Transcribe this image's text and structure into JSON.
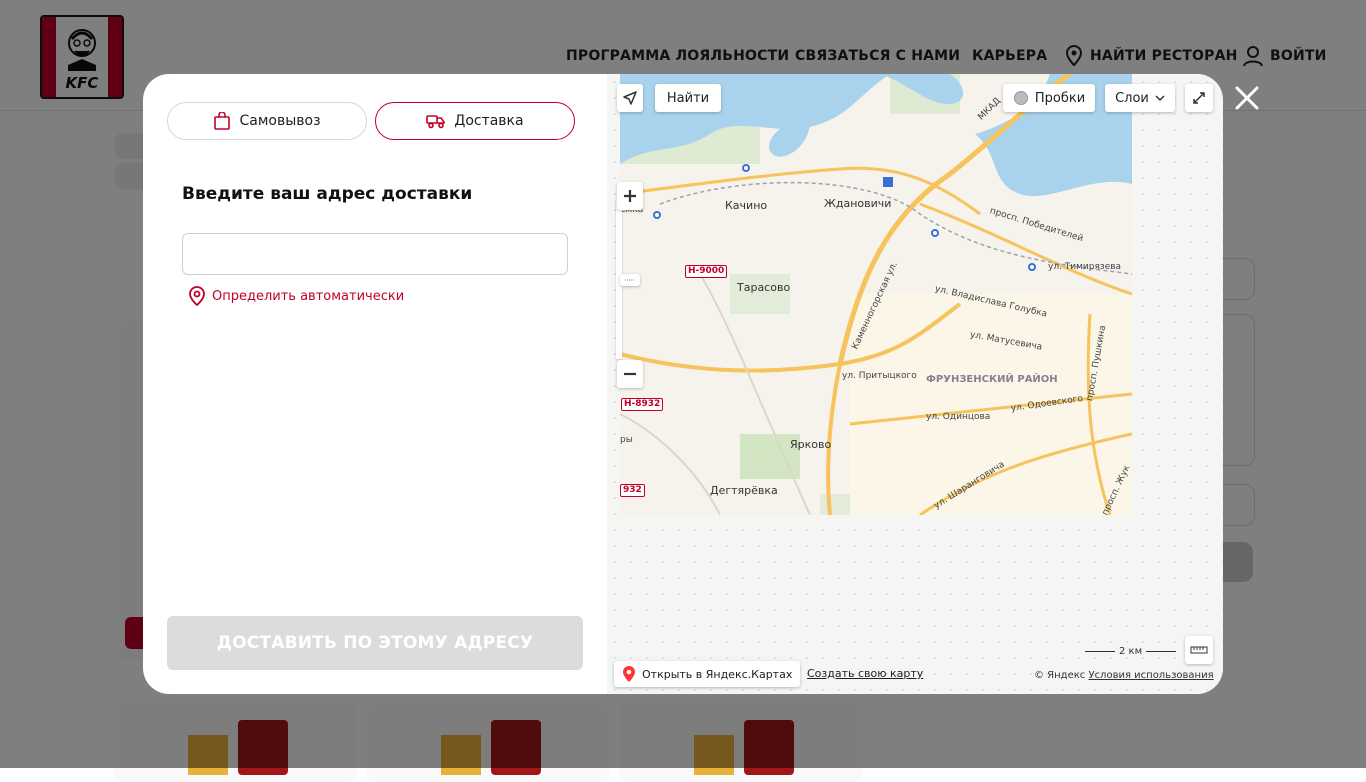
{
  "header": {
    "logo_text": "KFC",
    "nav": {
      "loyalty": "ПРОГРАММА ЛОЯЛЬНОСТИ",
      "contact": "СВЯЗАТЬСЯ С НАМИ",
      "career": "КАРЬЕРА",
      "find_restaurant": "НАЙТИ РЕСТОРАН",
      "login": "ВОЙТИ"
    }
  },
  "modal": {
    "tabs": {
      "pickup": "Самовывоз",
      "delivery": "Доставка"
    },
    "heading": "Введите ваш адрес доставки",
    "address_value": "",
    "address_placeholder": "",
    "geo_link": "Определить автоматически",
    "submit_label": "ДОСТАВИТЬ ПО ЭТОМУ АДРЕСУ"
  },
  "map": {
    "find_button": "Найти",
    "traffic_button": "Пробки",
    "layers_button": "Слои",
    "labels": {
      "kachino": "Качино",
      "zhdanovichi": "Ждановичи",
      "tarasovo": "Тарасово",
      "yarkovo": "Ярково",
      "degtyarevka": "Дегтярёвка",
      "pobediteley": "просп. Победителей",
      "timiryazeva": "ул. Тимирязева",
      "golubka": "ул. Владислава Голубка",
      "matusevicha": "ул. Матусевича",
      "pritytskogo": "ул. Притыцкого",
      "district": "ФРУНЗЕНСКИЙ РАЙОН",
      "odintsova": "ул. Одинцова",
      "odoevskogo": "ул. Одоевского",
      "kamennogorskaya": "Каменногорская ул.",
      "sharangovicha": "ул. Шаранговича",
      "pushkina": "просп. Пушкина",
      "mkad": "МКАД",
      "zhuk": "просп. Жук",
      "gorka": "ёмка",
      "ry": "ры"
    },
    "road_badges": {
      "n9000": "Н-9000",
      "n8932": "Н-8932",
      "n932": "932"
    },
    "open_in_yandex": "Открыть в Яндекс.Картах",
    "create_map": "Создать свою карту",
    "scale": "2 км",
    "copyright_prefix": "© Яндекс",
    "terms": "Условия использования"
  },
  "colors": {
    "brand_red": "#c0002a",
    "disabled_button": "#dcdcdc",
    "overlay": "rgba(0,0,0,0.5)"
  }
}
